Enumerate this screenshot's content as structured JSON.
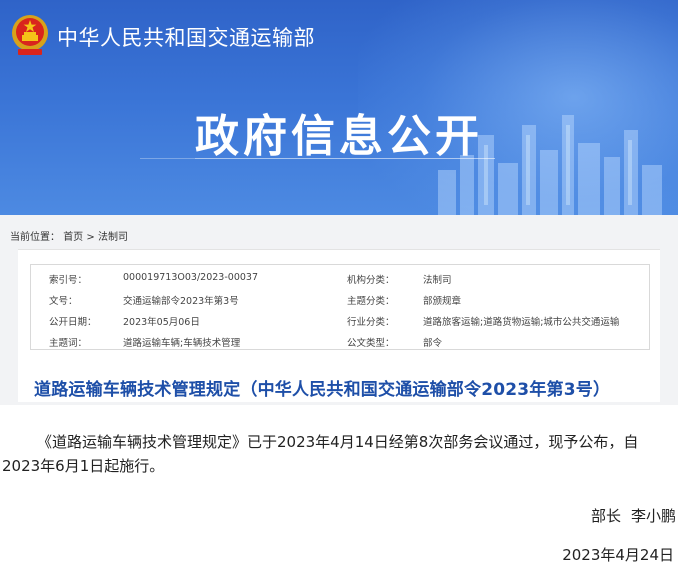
{
  "header": {
    "ministry_name": "中华人民共和国交通运输部",
    "section_title": "政府信息公开",
    "colors": {
      "banner": "#3a74d6",
      "title_link": "#1e4fa8"
    },
    "emblem_icon": "national-emblem-icon"
  },
  "breadcrumb": {
    "label": "当前位置：",
    "home": "首页",
    "separator": " > ",
    "current": "法制司"
  },
  "meta": {
    "rows": [
      {
        "k1": "索引号：",
        "v1": "000019713O03/2023-00037",
        "k2": "机构分类：",
        "v2": "法制司"
      },
      {
        "k1": "文号：",
        "v1": "交通运输部令2023年第3号",
        "k2": "主题分类：",
        "v2": "部颁规章"
      },
      {
        "k1": "公开日期：",
        "v1": "2023年05月06日",
        "k2": "行业分类：",
        "v2": "道路旅客运输;道路货物运输;城市公共交通运输"
      },
      {
        "k1": "主题词：",
        "v1": "道路运输车辆;车辆技术管理",
        "k2": "公文类型：",
        "v2": "部令"
      }
    ]
  },
  "document": {
    "title": "道路运输车辆技术管理规定（中华人民共和国交通运输部令2023年第3号）",
    "body": "《道路运输车辆技术管理规定》已于2023年4月14日经第8次部务会议通过，现予公布，自2023年6月1日起施行。",
    "signer_title": "部长",
    "signer_name": "李小鹏",
    "date": "2023年4月24日"
  }
}
